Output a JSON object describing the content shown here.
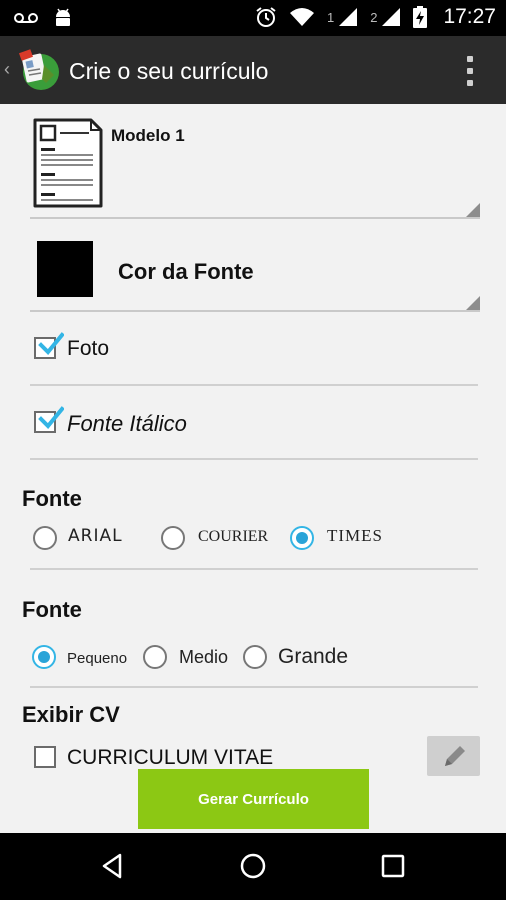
{
  "status_bar": {
    "time": "17:27",
    "sim1": "1",
    "sim2": "2",
    "icons": [
      "voicemail-icon",
      "android-icon",
      "alarm-icon",
      "wifi-icon",
      "signal-icon",
      "signal-icon",
      "battery-charging-icon"
    ]
  },
  "action_bar": {
    "title": "Crie o seu currículo",
    "icons": [
      "up-arrow-icon",
      "app-logo-icon",
      "overflow-menu-icon"
    ]
  },
  "template": {
    "label": "Modelo 1"
  },
  "font_color": {
    "label": "Cor da Fonte",
    "value": "#000000"
  },
  "options": {
    "photo": {
      "label": "Foto",
      "checked": true
    },
    "italic": {
      "label": "Fonte Itálico",
      "checked": true
    }
  },
  "font_family": {
    "title": "Fonte",
    "options": [
      "ARIAL",
      "COURIER",
      "TIMES"
    ],
    "selected": "TIMES"
  },
  "font_size": {
    "title": "Fonte",
    "options": [
      "Pequeno",
      "Medio",
      "Grande"
    ],
    "selected": "Pequeno"
  },
  "show_cv": {
    "title": "Exibir CV",
    "label": "CURRICULUM VITAE",
    "checked": false
  },
  "generate_button": {
    "label": "Gerar Currículo"
  },
  "nav_bar": {
    "icons": [
      "back-icon",
      "home-icon",
      "recents-icon"
    ]
  },
  "colors": {
    "accent": "#33b5e5",
    "button": "#8cc814",
    "action_bar": "#2b2b2b",
    "background": "#f2f2f2"
  }
}
